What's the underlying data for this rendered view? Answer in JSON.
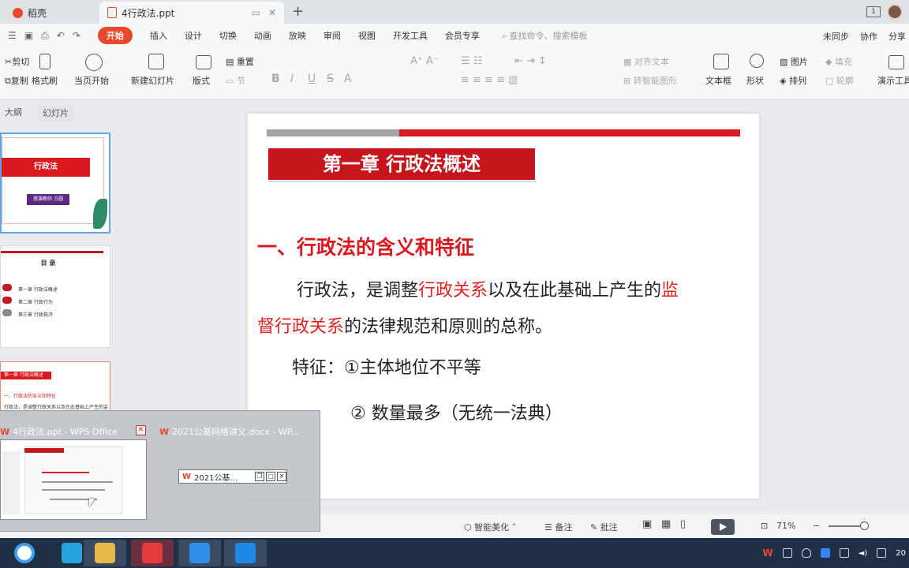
{
  "tabs": {
    "home_label": "稻壳",
    "doc_label": "4行政法.ppt"
  },
  "menu": {
    "items": [
      "开始",
      "插入",
      "设计",
      "切换",
      "动画",
      "放映",
      "审阅",
      "视图",
      "开发工具",
      "会员专享"
    ],
    "active": "开始",
    "search_placeholder": "查找命令、搜索模板",
    "right": [
      "未同步",
      "协作",
      "分享"
    ]
  },
  "ribbon": {
    "cut": "剪切",
    "copy": "复制",
    "format_painter": "格式刷",
    "from_current": "当页开始",
    "new_slide": "新建幻灯片",
    "layout": "版式",
    "reset": "重置",
    "section": "节",
    "align_text": "对齐文本",
    "to_smartart": "转智能图形",
    "textbox": "文本框",
    "shape": "形状",
    "arrange": "排列",
    "picture": "图片",
    "fill": "填充",
    "outline": "轮廓",
    "presenter_tools": "演示工具"
  },
  "view_tabs": [
    "大纲",
    "幻灯片"
  ],
  "thumbnails": {
    "t1_title": "行政法",
    "t1_sub": "授课教师 方圆",
    "t2_title": "目 录",
    "t2_items": [
      "第一章 行政法概述",
      "第二章 行政行为",
      "第三章 行政救济"
    ],
    "t3_bar": "第一章 行政法概述",
    "t3_line1": "一、行政法的含义和特征",
    "t3_line2": "行政法，是调整行政关系以及在此基础上产生的监督行政关系"
  },
  "slide": {
    "chapter": "第一章 行政法概述",
    "section": "一、行政法的含义和特征",
    "def_a": "行政法，是调整",
    "def_b": "行政关系",
    "def_c": "以及在此基础上产生的",
    "def_d": "监",
    "def_e": "督行政关系",
    "def_f": "的法律规范和原则的总称。",
    "feature_1": "特征：①主体地位不平等",
    "feature_2": "② 数量最多（无统一法典）"
  },
  "status": {
    "beautify": "智能美化",
    "notes": "备注",
    "comment": "批注",
    "zoom": "71%"
  },
  "preview": {
    "win1_title": "4行政法.ppt - WPS Office",
    "win2_title": "2021公基网络讲义.docx - WP...",
    "win2_mini": "2021公基..."
  },
  "tray": {
    "clock": "20"
  },
  "colors": {
    "accent": "#e8482b",
    "slide_red": "#c5161d",
    "text_red": "#e02424",
    "taskbar": "#1f2f45"
  }
}
